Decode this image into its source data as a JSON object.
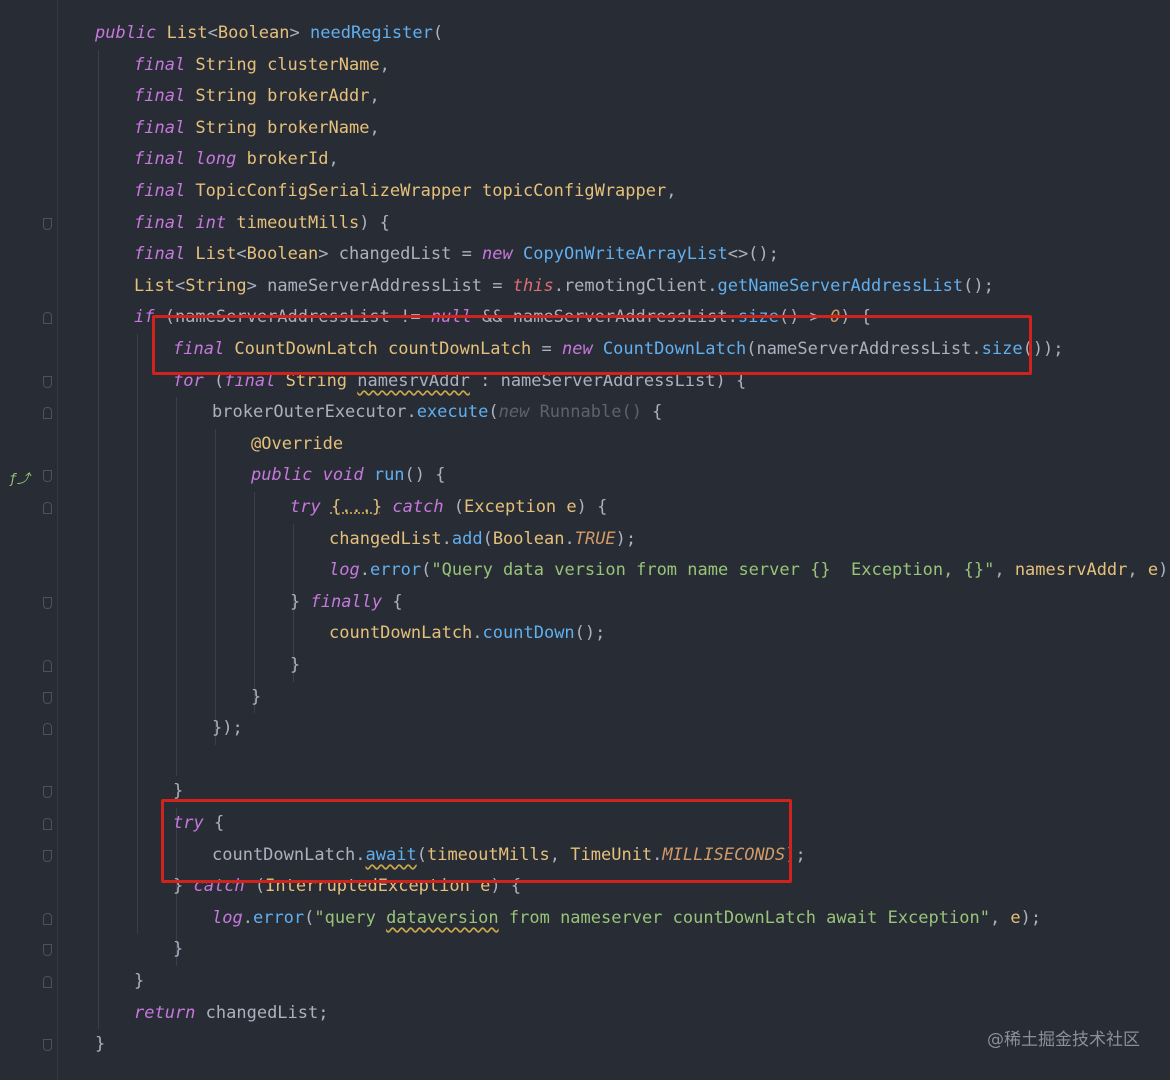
{
  "editor": {
    "lines": [
      [
        [
          "kw",
          "public "
        ],
        [
          "ty",
          "List"
        ],
        [
          "pl",
          "<"
        ],
        [
          "ty",
          "Boolean"
        ],
        [
          "pl",
          "> "
        ],
        [
          "fn",
          "needRegister"
        ],
        [
          "pl",
          "("
        ]
      ],
      [
        [
          "kw",
          "final "
        ],
        [
          "ty",
          "String "
        ],
        [
          "pr",
          "clusterName"
        ],
        [
          "pl",
          ","
        ]
      ],
      [
        [
          "kw",
          "final "
        ],
        [
          "ty",
          "String "
        ],
        [
          "pr",
          "brokerAddr"
        ],
        [
          "pl",
          ","
        ]
      ],
      [
        [
          "kw",
          "final "
        ],
        [
          "ty",
          "String "
        ],
        [
          "pr",
          "brokerName"
        ],
        [
          "pl",
          ","
        ]
      ],
      [
        [
          "kw",
          "final long "
        ],
        [
          "pr",
          "brokerId"
        ],
        [
          "pl",
          ","
        ]
      ],
      [
        [
          "kw",
          "final "
        ],
        [
          "ty",
          "TopicConfigSerializeWrapper "
        ],
        [
          "pr",
          "topicConfigWrapper"
        ],
        [
          "pl",
          ","
        ]
      ],
      [
        [
          "kw",
          "final int "
        ],
        [
          "pr",
          "timeoutMills"
        ],
        [
          "pl",
          ") {"
        ]
      ],
      [
        [
          "kw",
          "final "
        ],
        [
          "ty",
          "List"
        ],
        [
          "pl",
          "<"
        ],
        [
          "ty",
          "Boolean"
        ],
        [
          "pl",
          "> changedList = "
        ],
        [
          "kw",
          "new "
        ],
        [
          "fn",
          "CopyOnWriteArrayList"
        ],
        [
          "pl",
          "<>();"
        ]
      ],
      [
        [
          "ty",
          "List"
        ],
        [
          "pl",
          "<"
        ],
        [
          "ty",
          "String"
        ],
        [
          "pl",
          "> nameServerAddressList = "
        ],
        [
          "th",
          "this"
        ],
        [
          "pl",
          "."
        ],
        [
          "pl",
          "remotingClient"
        ],
        [
          "pl",
          "."
        ],
        [
          "fn",
          "getNameServerAddressList"
        ],
        [
          "pl",
          "();"
        ]
      ],
      [
        [
          "kw",
          "if "
        ],
        [
          "pl",
          "(nameServerAddressList != "
        ],
        [
          "kw",
          "null "
        ],
        [
          "pl",
          "&& nameServerAddressList."
        ],
        [
          "fn",
          "size"
        ],
        [
          "pl",
          "() > "
        ],
        [
          "cn",
          "0"
        ],
        [
          "pl",
          ") {"
        ]
      ],
      [
        [
          "kw",
          "final "
        ],
        [
          "ty",
          "CountDownLatch "
        ],
        [
          "pr",
          "countDownLatch"
        ],
        [
          "pl",
          " = "
        ],
        [
          "kw",
          "new "
        ],
        [
          "fn",
          "CountDownLatch"
        ],
        [
          "pl",
          "(nameServerAddressList."
        ],
        [
          "fn",
          "size"
        ],
        [
          "pl",
          "());"
        ]
      ],
      [
        [
          "kw",
          "for "
        ],
        [
          "pl",
          "("
        ],
        [
          "kw",
          "final "
        ],
        [
          "ty",
          "String "
        ],
        [
          "wv",
          "namesrvAddr"
        ],
        [
          "pl",
          " : nameServerAddressList) {"
        ]
      ],
      [
        [
          "pl",
          "brokerOuterExecutor."
        ],
        [
          "fn",
          "execute"
        ],
        [
          "pl",
          "("
        ],
        [
          "dim",
          "new "
        ],
        [
          "dimt",
          "Runnable"
        ],
        [
          "dimt",
          "() "
        ],
        [
          "pl",
          "{"
        ]
      ],
      [
        [
          "an",
          "@Override"
        ]
      ],
      [
        [
          "kw",
          "public void "
        ],
        [
          "fn",
          "run"
        ],
        [
          "pl",
          "() {"
        ]
      ],
      [
        [
          "kw",
          "try "
        ],
        [
          "fd",
          "{...}"
        ],
        [
          "kw",
          " catch "
        ],
        [
          "pl",
          "("
        ],
        [
          "ty",
          "Exception "
        ],
        [
          "pr",
          "e"
        ],
        [
          "pl",
          ") {"
        ]
      ],
      [
        [
          "pr",
          "changedList"
        ],
        [
          "pl",
          "."
        ],
        [
          "fn",
          "add"
        ],
        [
          "pl",
          "("
        ],
        [
          "ty",
          "Boolean"
        ],
        [
          "pl",
          "."
        ],
        [
          "cn",
          "TRUE"
        ],
        [
          "pl",
          ");"
        ]
      ],
      [
        [
          "kw",
          "log"
        ],
        [
          "pl",
          "."
        ],
        [
          "fn",
          "error"
        ],
        [
          "pl",
          "("
        ],
        [
          "st",
          "\"Query data version from name server {}  Exception, {}\""
        ],
        [
          "pl",
          ", "
        ],
        [
          "pr",
          "namesrvAddr"
        ],
        [
          "pl",
          ", "
        ],
        [
          "pr",
          "e"
        ],
        [
          "pl",
          ");"
        ]
      ],
      [
        [
          "pl",
          "} "
        ],
        [
          "kw",
          "finally "
        ],
        [
          "pl",
          "{"
        ]
      ],
      [
        [
          "pr",
          "countDownLatch"
        ],
        [
          "pl",
          "."
        ],
        [
          "fn",
          "countDown"
        ],
        [
          "pl",
          "();"
        ]
      ],
      [
        [
          "pl",
          "}"
        ]
      ],
      [
        [
          "pl",
          "}"
        ]
      ],
      [
        [
          "pl",
          "});"
        ]
      ],
      [],
      [
        [
          "pl",
          "}"
        ]
      ],
      [
        [
          "kw",
          "try "
        ],
        [
          "pl",
          "{"
        ]
      ],
      [
        [
          "pl",
          "countDownLatch."
        ],
        [
          "wvf",
          "await"
        ],
        [
          "pl",
          "("
        ],
        [
          "pr",
          "timeoutMills"
        ],
        [
          "pl",
          ", "
        ],
        [
          "ty",
          "TimeUnit"
        ],
        [
          "pl",
          "."
        ],
        [
          "cn",
          "MILLISECONDS"
        ],
        [
          "pl",
          ");"
        ]
      ],
      [
        [
          "pl",
          "} "
        ],
        [
          "kw",
          "catch "
        ],
        [
          "pl",
          "("
        ],
        [
          "ty",
          "InterruptedException "
        ],
        [
          "pr",
          "e"
        ],
        [
          "pl",
          ") {"
        ]
      ],
      [
        [
          "kw",
          "log"
        ],
        [
          "pl",
          "."
        ],
        [
          "fn",
          "error"
        ],
        [
          "pl",
          "("
        ],
        [
          "st",
          "\"query "
        ],
        [
          "stw",
          "dataversion"
        ],
        [
          "st",
          " from nameserver countDownLatch await Exception\""
        ],
        [
          "pl",
          ", "
        ],
        [
          "pr",
          "e"
        ],
        [
          "pl",
          ");"
        ]
      ],
      [
        [
          "pl",
          "}"
        ]
      ],
      [
        [
          "pl",
          "}"
        ]
      ],
      [
        [
          "kw",
          "return "
        ],
        [
          "pl",
          "changedList;"
        ]
      ],
      [
        [
          "pl",
          "}"
        ]
      ]
    ],
    "indents": [
      0,
      1,
      1,
      1,
      1,
      1,
      1,
      1,
      1,
      1,
      2,
      2,
      3,
      4,
      4,
      5,
      6,
      6,
      5,
      6,
      5,
      4,
      3,
      0,
      2,
      2,
      3,
      2,
      3,
      2,
      1,
      1,
      0
    ]
  },
  "watermark": "@稀土掘金技术社区",
  "highlight_color": "#d0231c"
}
